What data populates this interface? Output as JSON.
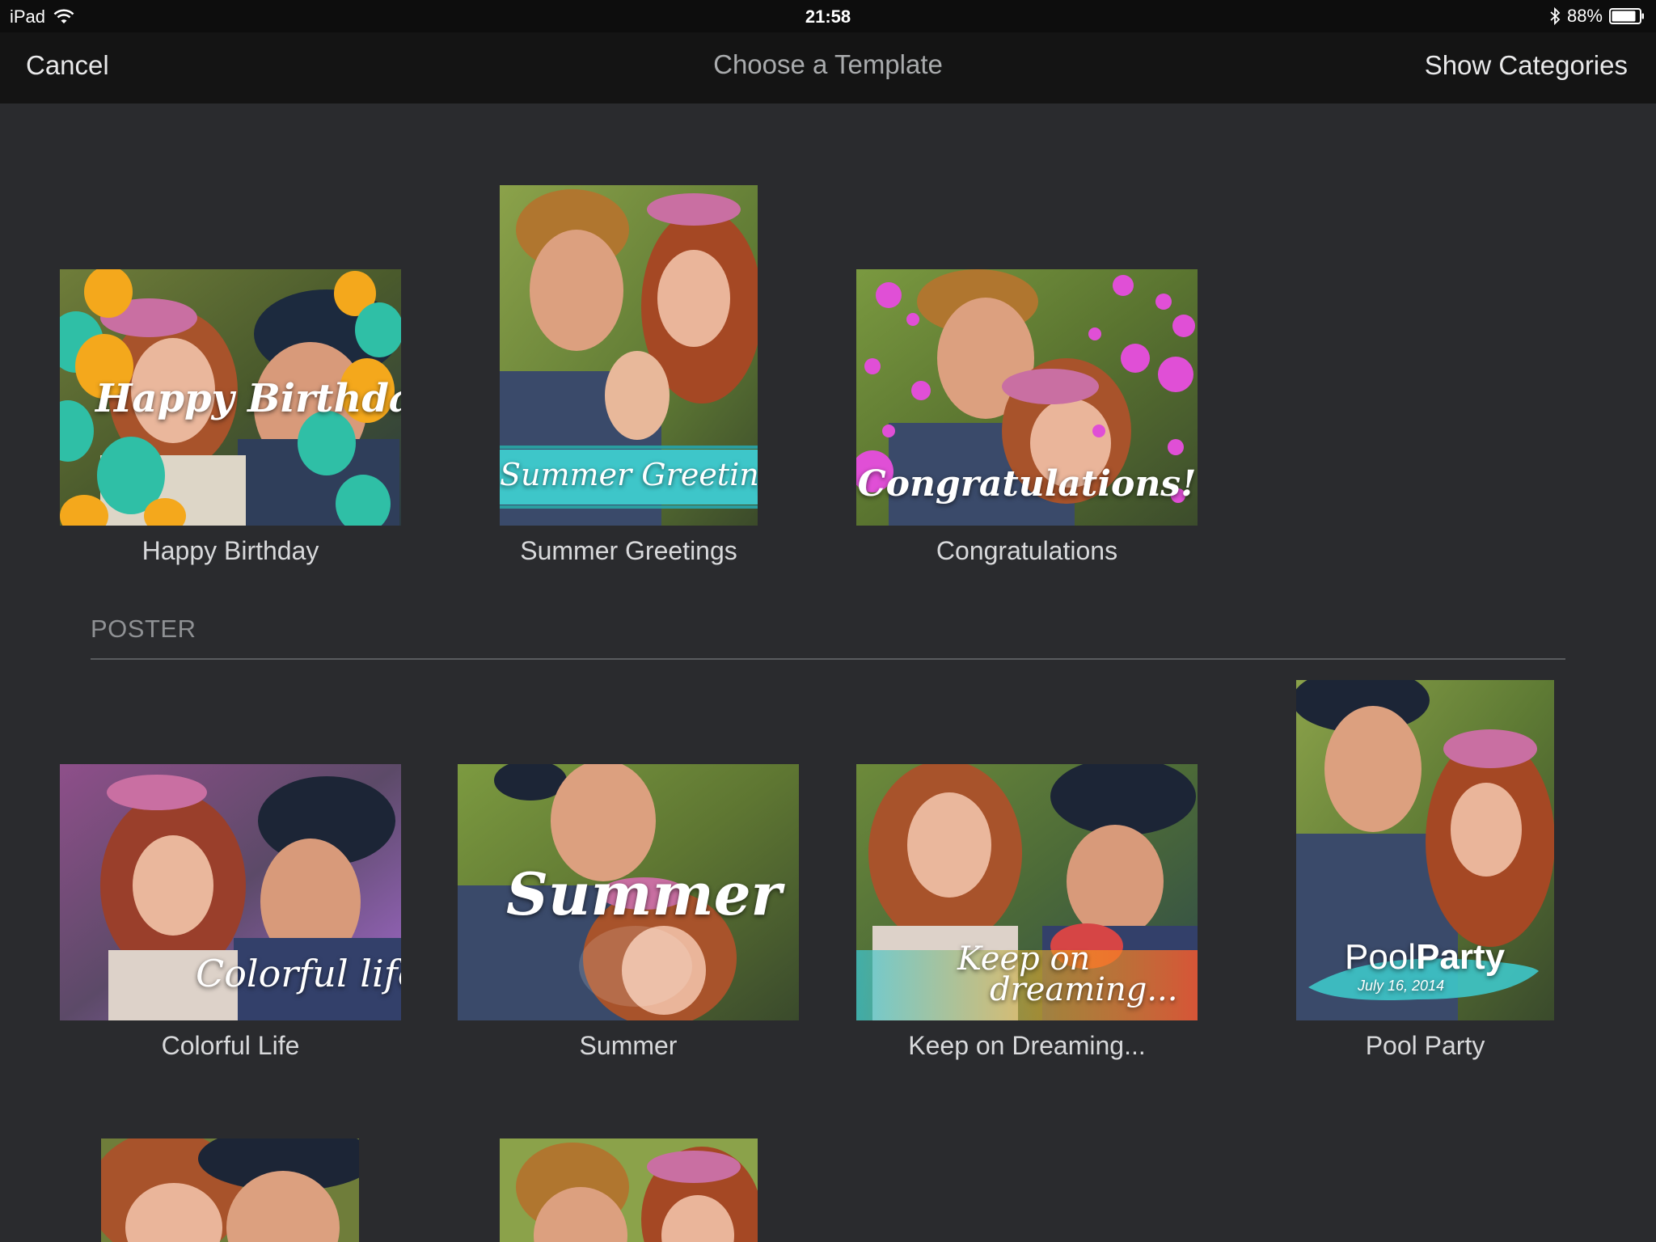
{
  "status_bar": {
    "carrier": "iPad",
    "time": "21:58",
    "battery_percent": "88%",
    "battery_level": 0.88
  },
  "nav": {
    "cancel_label": "Cancel",
    "title": "Choose a Template",
    "show_categories_label": "Show Categories"
  },
  "cards": [
    {
      "label": "Happy Birthday",
      "overlay": "Happy Birthday!"
    },
    {
      "label": "Summer Greetings",
      "overlay": "Summer Greetings"
    },
    {
      "label": "Congratulations",
      "overlay": "Congratulations!"
    }
  ],
  "poster_section": {
    "header": "POSTER"
  },
  "posters": [
    {
      "label": "Colorful Life",
      "overlay": "Colorful life"
    },
    {
      "label": "Summer",
      "overlay": "Summer"
    },
    {
      "label": "Keep on Dreaming...",
      "overlay_line1": "Keep on",
      "overlay_line2": "dreaming..."
    },
    {
      "label": "Pool Party",
      "overlay_pool": "Pool",
      "overlay_party": "Party",
      "overlay_date": "July 16, 2014"
    }
  ],
  "colors": {
    "background": "#2a2b2e",
    "status_bar": "#0d0d0d",
    "nav_bar": "#141414",
    "label_text": "#d8d9db",
    "banner_teal": "#3ec6c9",
    "balloon_teal": "#2fbfa6",
    "balloon_orange": "#f4a81c",
    "flower_pink": "#e04fd6"
  }
}
